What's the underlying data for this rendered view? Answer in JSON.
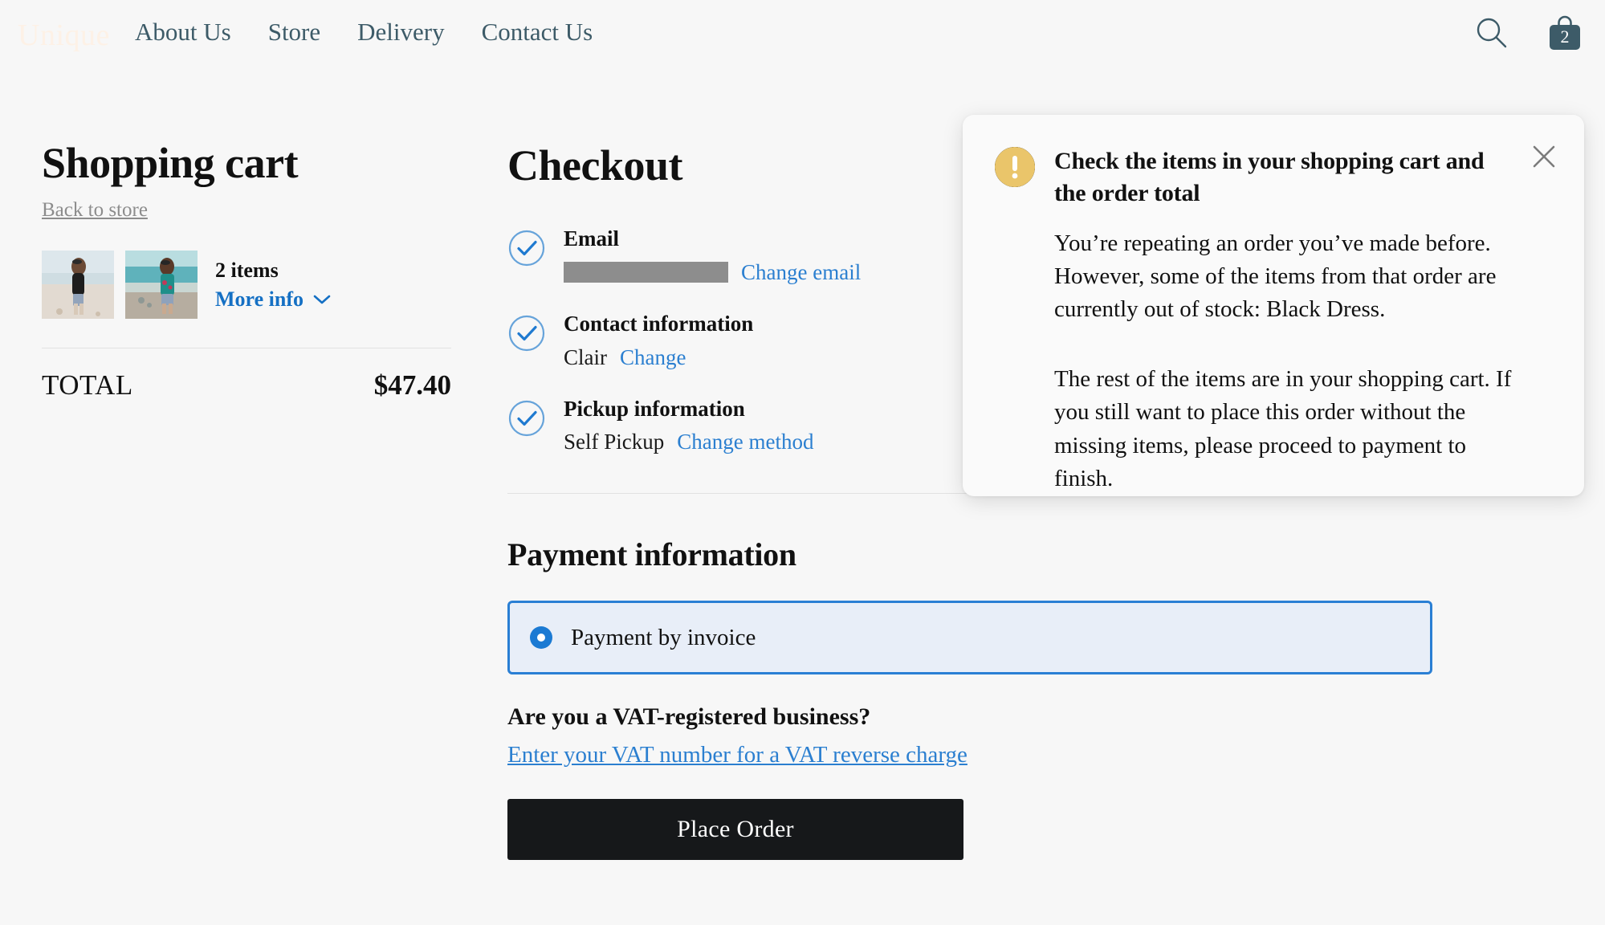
{
  "header": {
    "logo": "Unique",
    "nav": [
      {
        "label": "About Us"
      },
      {
        "label": "Store"
      },
      {
        "label": "Delivery"
      },
      {
        "label": "Contact Us"
      }
    ],
    "search_icon": "search-icon",
    "cart_icon": "shopping-bag-icon",
    "cart_count": "2"
  },
  "cart": {
    "title": "Shopping cart",
    "back_link": "Back to store",
    "items_count": "2 items",
    "more_info": "More info",
    "chevron_icon": "chevron-down-icon",
    "thumbnails": [
      {
        "alt": "Woman in black tank top on the beach"
      },
      {
        "alt": "Woman in teal floral top on the beach"
      }
    ],
    "total_label": "TOTAL",
    "total_value": "$47.40"
  },
  "checkout": {
    "title": "Checkout",
    "steps": [
      {
        "label": "Email",
        "value": "",
        "value_redacted": true,
        "action": "Change email",
        "status_icon": "check-circle-icon"
      },
      {
        "label": "Contact information",
        "value": "Clair",
        "value_redacted": false,
        "action": "Change",
        "status_icon": "check-circle-icon"
      },
      {
        "label": "Pickup information",
        "value": "Self Pickup",
        "value_redacted": false,
        "action": "Change method",
        "status_icon": "check-circle-icon"
      }
    ]
  },
  "payment": {
    "title": "Payment information",
    "selected_option": "Payment by invoice",
    "radio_icon": "radio-selected-icon",
    "vat_question": "Are you a VAT-registered business?",
    "vat_link": "Enter your VAT number for a VAT reverse charge",
    "place_order": "Place Order"
  },
  "toast": {
    "warning_icon": "warning-exclamation-icon",
    "close_icon": "close-icon",
    "heading": "Check the items in your shopping cart and the order total",
    "paragraph_1": "You’re repeating an order you’ve made before. However, some of the items from that order are currently out of stock: Black Dress.",
    "paragraph_2": "The rest of the items are in your shopping cart. If you still want to place this order without the missing items, please proceed to payment to finish."
  },
  "colors": {
    "page_background": "#f7f7f7",
    "nav_text": "#3d5b68",
    "logo": "#fdf1e6",
    "link_blue": "#2b7fd0",
    "accent_blue": "#2a7fd4",
    "warning_amber": "#edc濃",
    "button_dark": "#16181a",
    "muted_text": "#8c8c8c"
  }
}
